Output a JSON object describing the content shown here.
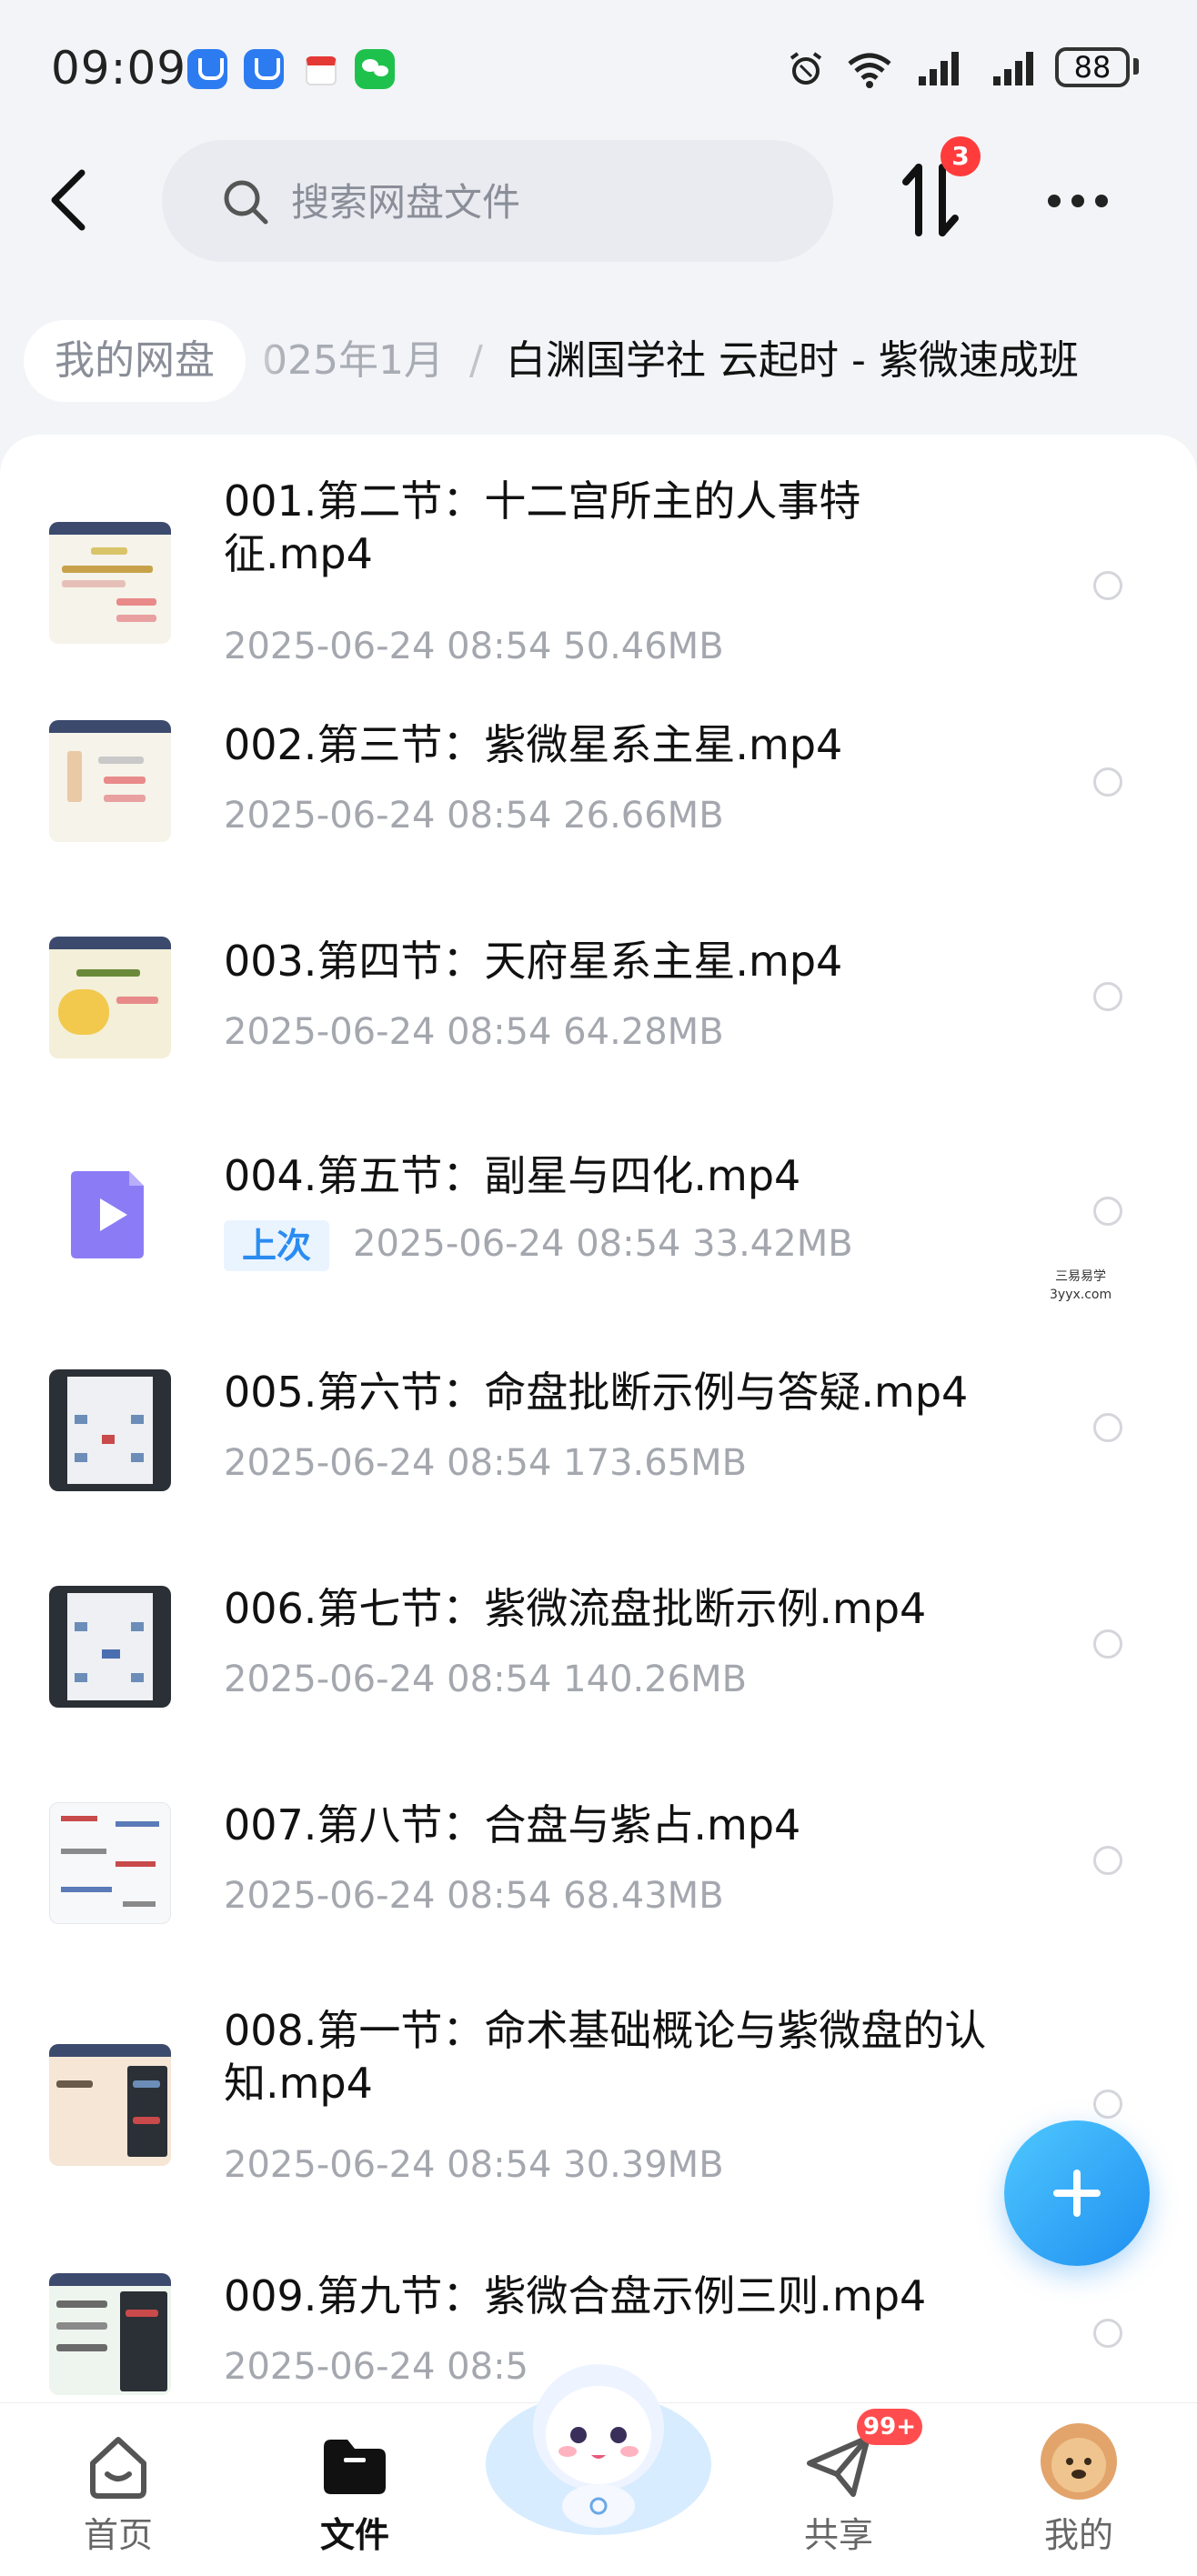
{
  "status_bar": {
    "time": "09:09",
    "battery": "88"
  },
  "header": {
    "search_placeholder": "搜索网盘文件",
    "transfer_badge": "3"
  },
  "breadcrumb": {
    "root": "我的网盘",
    "year": "025年1月",
    "separator": "/",
    "current": "白渊国学社 云起时 - 紫微速成班"
  },
  "files": [
    {
      "name": "001.第二节：十二宫所主的人事特征.mp4",
      "meta": "2025-06-24  08:54  50.46MB"
    },
    {
      "name": "002.第三节：紫微星系主星.mp4",
      "meta": "2025-06-24  08:54  26.66MB"
    },
    {
      "name": "003.第四节：天府星系主星.mp4",
      "meta": "2025-06-24  08:54  64.28MB"
    },
    {
      "name": "004.第五节：副星与四化.mp4",
      "meta": "2025-06-24  08:54  33.42MB",
      "badge": "上次"
    },
    {
      "name": "005.第六节：命盘批断示例与答疑.mp4",
      "meta": "2025-06-24  08:54  173.65MB"
    },
    {
      "name": "006.第七节：紫微流盘批断示例.mp4",
      "meta": "2025-06-24  08:54  140.26MB"
    },
    {
      "name": "007.第八节：合盘与紫占.mp4",
      "meta": "2025-06-24  08:54  68.43MB"
    },
    {
      "name": "008.第一节：命术基础概论与紫微盘的认知.mp4",
      "meta": "2025-06-24  08:54  30.39MB"
    },
    {
      "name": "009.第九节：紫微合盘示例三则.mp4",
      "meta": "2025-06-24  08:5"
    }
  ],
  "watermark": {
    "line1": "三易易学",
    "line2": "3yyx.com"
  },
  "bottom_nav": {
    "home": "首页",
    "files": "文件",
    "share": "共享",
    "share_badge": "99+",
    "mine": "我的"
  },
  "colors": {
    "accent": "#1f8ff0",
    "badge": "#ff3b3b",
    "last_badge_bg": "#eaf4ff"
  }
}
